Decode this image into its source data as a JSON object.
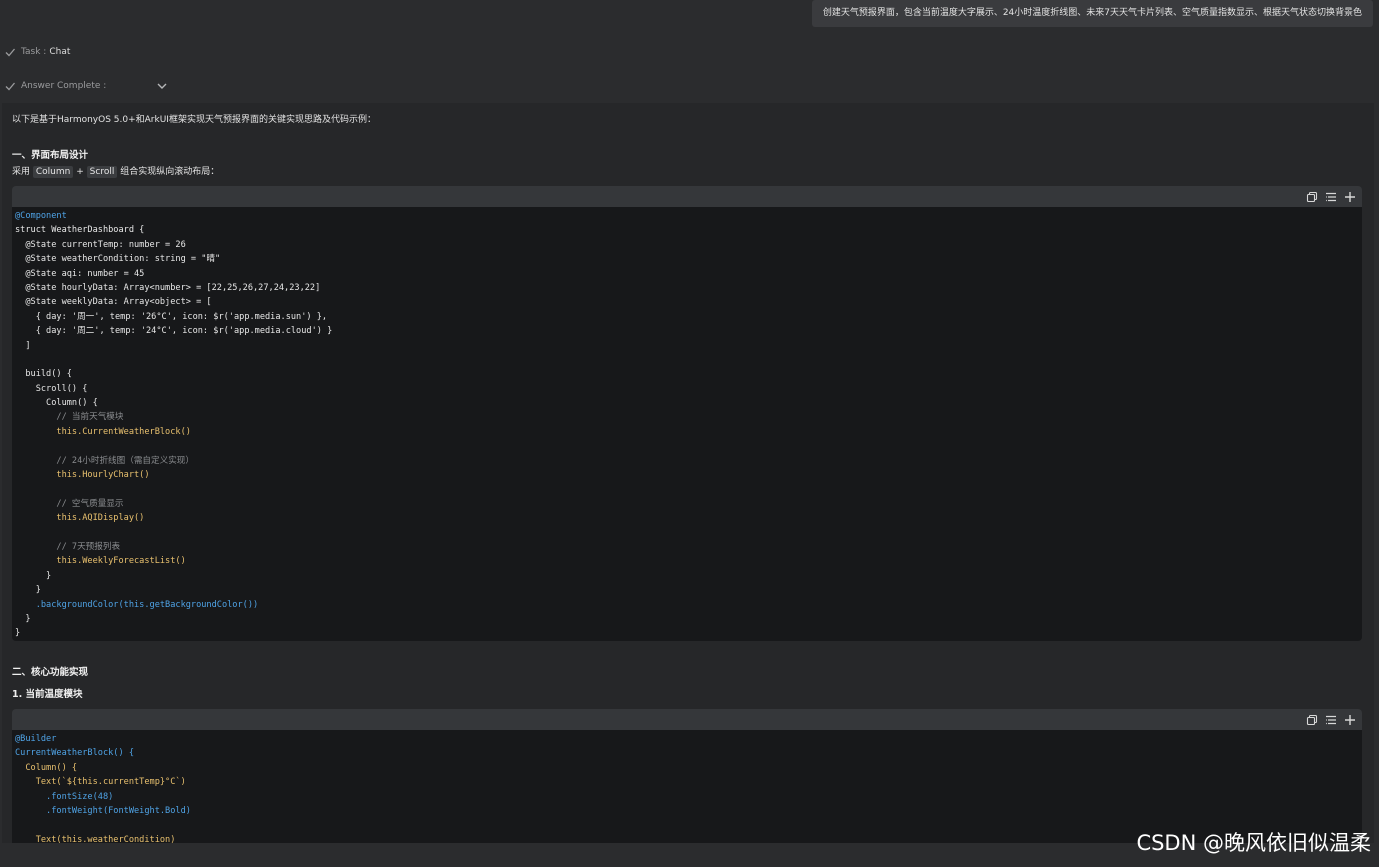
{
  "user_message": "创建天气预报界面，包含当前温度大字展示、24小时温度折线图、未来7天天气卡片列表、空气质量指数显示、根据天气状态切换背景色",
  "task_row": {
    "label": "Task :",
    "value": "Chat"
  },
  "answer_row": {
    "label": "Answer Complete :"
  },
  "answer": {
    "intro": "以下是基于HarmonyOS 5.0+和ArkUI框架实现天气预报界面的关键实现思路及代码示例：",
    "section1_title": "一、界面布局设计",
    "section1_desc_prefix": "采用",
    "section1_code_a": "Column",
    "section1_desc_plus": "+",
    "section1_code_b": "Scroll",
    "section1_desc_suffix": "组合实现纵向滚动布局：",
    "section2_title": "二、核心功能实现",
    "section2_sub": "1. 当前温度模块"
  },
  "code_blocks": [
    {
      "lines": [
        "@Component",
        "struct WeatherDashboard {",
        "  @State currentTemp: number = 26",
        "  @State weatherCondition: string = \"晴\"",
        "  @State aqi: number = 45",
        "  @State hourlyData: Array<number> = [22,25,26,27,24,23,22]",
        "  @State weeklyData: Array<object> = [",
        "    { day: '周一', temp: '26°C', icon: $r('app.media.sun') },",
        "    { day: '周二', temp: '24°C', icon: $r('app.media.cloud') }",
        "  ]",
        "",
        "  build() {",
        "    Scroll() {",
        "      Column() {",
        "        // 当前天气模块",
        "        this.CurrentWeatherBlock()",
        "",
        "        // 24小时折线图（需自定义实现）",
        "        this.HourlyChart()",
        "",
        "        // 空气质量显示",
        "        this.AQIDisplay()",
        "",
        "        // 7天预报列表",
        "        this.WeeklyForecastList()",
        "      }",
        "    }",
        "    .backgroundColor(this.getBackgroundColor())",
        "  }",
        "}"
      ]
    },
    {
      "lines": [
        "@Builder",
        "CurrentWeatherBlock() {",
        "  Column() {",
        "    Text(`${this.currentTemp}°C`)",
        "      .fontSize(48)",
        "      .fontWeight(FontWeight.Bold)",
        "",
        "    Text(this.weatherCondition)"
      ]
    }
  ],
  "toolbar_icons": [
    "copy-icon",
    "wrap-lines-icon",
    "expand-icon"
  ],
  "watermark": "CSDN @晚风依旧似温柔",
  "colors": {
    "background": "#2b2c2e",
    "answer_panel": "#262729",
    "code_background": "#17181a",
    "decorator": "#4fa3e6",
    "string": "#98c379",
    "number": "#e5a05c"
  }
}
